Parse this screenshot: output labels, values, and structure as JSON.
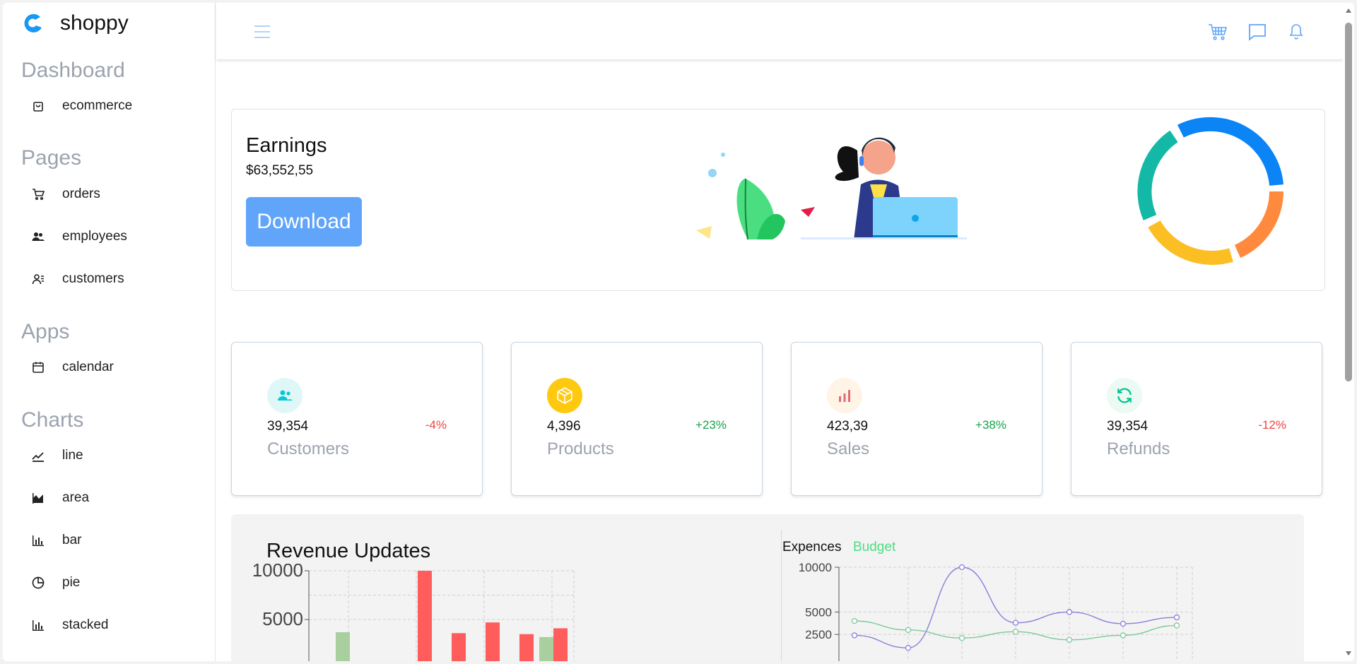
{
  "brand": {
    "name": "shoppy",
    "icon": "logo-icon"
  },
  "sidebar": {
    "sections": [
      {
        "heading": "Dashboard",
        "items": [
          {
            "label": "ecommerce",
            "icon": "shopping-bag-icon"
          }
        ]
      },
      {
        "heading": "Pages",
        "items": [
          {
            "label": "orders",
            "icon": "cart-icon"
          },
          {
            "label": "employees",
            "icon": "users-icon"
          },
          {
            "label": "customers",
            "icon": "customers-icon"
          }
        ]
      },
      {
        "heading": "Apps",
        "items": [
          {
            "label": "calendar",
            "icon": "calendar-icon"
          }
        ]
      },
      {
        "heading": "Charts",
        "items": [
          {
            "label": "line",
            "icon": "line-chart-icon"
          },
          {
            "label": "area",
            "icon": "area-chart-icon"
          },
          {
            "label": "bar",
            "icon": "bar-chart-icon"
          },
          {
            "label": "pie",
            "icon": "pie-chart-icon"
          },
          {
            "label": "stacked",
            "icon": "stacked-chart-icon"
          }
        ]
      }
    ]
  },
  "topbar": {
    "icons": [
      "menu-icon",
      "cart-icon",
      "chat-icon",
      "bell-icon"
    ]
  },
  "earnings": {
    "title": "Earnings",
    "value": "$63,552,55",
    "download_label": "Download",
    "donut_colors": [
      "#0b84f5",
      "#ff8a3d",
      "#fbbf24",
      "#14b8a6"
    ]
  },
  "stats": [
    {
      "value": "39,354",
      "change": "-4%",
      "label": "Customers",
      "icon": "customers-icon",
      "icon_bg": "#e0f7f7",
      "icon_color": "#03c9d7",
      "change_color": "#ef4444"
    },
    {
      "value": "4,396",
      "change": "+23%",
      "label": "Products",
      "icon": "box-icon",
      "icon_bg": "#fec90f",
      "icon_color": "#ffffff",
      "change_color": "#16a34a"
    },
    {
      "value": "423,39",
      "change": "+38%",
      "label": "Sales",
      "icon": "sales-chart-icon",
      "icon_bg": "#fff4e5",
      "icon_color": "#e46a76",
      "change_color": "#16a34a"
    },
    {
      "value": "39,354",
      "change": "-12%",
      "label": "Refunds",
      "icon": "refresh-icon",
      "icon_bg": "#ebfaf2",
      "icon_color": "#00c292",
      "change_color": "#ef4444"
    }
  ],
  "revenue": {
    "title": "Revenue Updates",
    "legend_expences": "Expences",
    "legend_budget": "Budget"
  },
  "chart_data": [
    {
      "type": "bar",
      "title": "Revenue Updates",
      "yticks": [
        10000,
        5000
      ],
      "ylim": [
        0,
        10500
      ],
      "grid": true,
      "bars": [
        {
          "series": "Budget",
          "value": 3700,
          "color": "#a9cf9f"
        },
        {
          "series": "Expense",
          "value": 10000,
          "color": "#ff5c5c"
        },
        {
          "series": "Expense",
          "value": 3600,
          "color": "#ff5c5c"
        },
        {
          "series": "Expense",
          "value": 4700,
          "color": "#ff5c5c"
        },
        {
          "series": "Expense",
          "value": 3500,
          "color": "#ff5c5c"
        },
        {
          "series": "Budget",
          "value": 3200,
          "color": "#a9cf9f"
        },
        {
          "series": "Expense",
          "value": 4100,
          "color": "#ff5c5c"
        }
      ]
    },
    {
      "type": "line",
      "yticks": [
        10000,
        5000,
        2500
      ],
      "ylim": [
        0,
        10500
      ],
      "grid": true,
      "series": [
        {
          "name": "Expences",
          "color": "#8b7fd9",
          "values": [
            2400,
            1000,
            10000,
            3800,
            5000,
            3700,
            4400
          ]
        },
        {
          "name": "Budget",
          "color": "#7cc99a",
          "values": [
            4000,
            3000,
            2100,
            2800,
            1900,
            2400,
            3500
          ]
        }
      ]
    }
  ]
}
